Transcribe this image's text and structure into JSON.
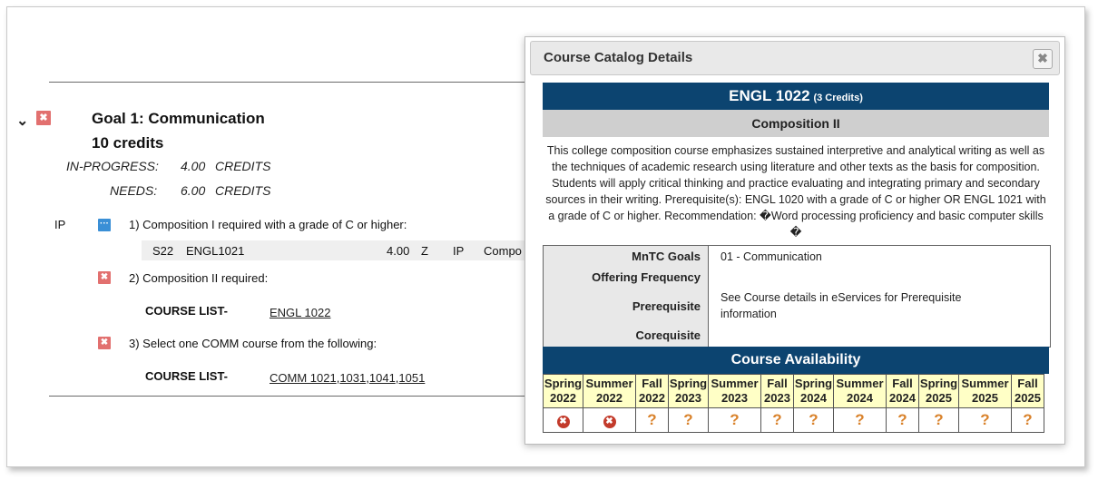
{
  "goal": {
    "title": "Goal 1: Communication",
    "credits": "10 credits",
    "in_progress_label": "IN-PROGRESS:",
    "in_progress_value": "4.00",
    "in_progress_unit": "CREDITS",
    "needs_label": "NEEDS:",
    "needs_value": "6.00",
    "needs_unit": "CREDITS"
  },
  "requirements": [
    {
      "status": "IP",
      "text": "1) Composition I required with a grade of C or higher:",
      "course_row": {
        "term": "S22",
        "course": "ENGL1021",
        "credits": "4.00",
        "flag": "Z",
        "status": "IP",
        "title": "Compo"
      }
    },
    {
      "text": "2) Composition II required:",
      "course_list_label": "COURSE LIST-",
      "courses": "ENGL 1022"
    },
    {
      "text": "3) Select one COMM course from the following:",
      "course_list_label": "COURSE LIST-",
      "courses": [
        "COMM 1021",
        "1031",
        "1041",
        "1051"
      ]
    }
  ],
  "dialog": {
    "title": "Course Catalog Details",
    "close_glyph": "✖",
    "course_code": "ENGL 1022",
    "course_credits": "(3 Credits)",
    "course_name": "Composition II",
    "description": "This college composition course emphasizes sustained interpretive and analytical writing as well as the techniques of academic research using literature and other texts as the basis for composition. Students will apply critical thinking and practice evaluating and integrating primary and secondary sources in their writing. Prerequisite(s): ENGL 1020 with a grade of C or higher OR ENGL 1021 with a grade of C or higher. Recommendation: �Word processing proficiency and basic computer skills �",
    "info": {
      "mntc_label": "MnTC Goals",
      "mntc_value": "01 - Communication",
      "frequency_label": "Offering Frequency",
      "frequency_value": "",
      "prereq_label": "Prerequisite",
      "prereq_value": "See Course details in eServices for Prerequisite information",
      "coreq_label": "Corequisite",
      "coreq_value": ""
    },
    "availability_title": "Course Availability",
    "terms": [
      {
        "season": "Spring",
        "year": "2022",
        "status": "not-offered"
      },
      {
        "season": "Summer",
        "year": "2022",
        "status": "not-offered"
      },
      {
        "season": "Fall",
        "year": "2022",
        "status": "unknown"
      },
      {
        "season": "Spring",
        "year": "2023",
        "status": "unknown"
      },
      {
        "season": "Summer",
        "year": "2023",
        "status": "unknown"
      },
      {
        "season": "Fall",
        "year": "2023",
        "status": "unknown"
      },
      {
        "season": "Spring",
        "year": "2024",
        "status": "unknown"
      },
      {
        "season": "Summer",
        "year": "2024",
        "status": "unknown"
      },
      {
        "season": "Fall",
        "year": "2024",
        "status": "unknown"
      },
      {
        "season": "Spring",
        "year": "2025",
        "status": "unknown"
      },
      {
        "season": "Summer",
        "year": "2025",
        "status": "unknown"
      },
      {
        "season": "Fall",
        "year": "2025",
        "status": "unknown"
      }
    ],
    "status_glyphs": {
      "not-offered": "✖",
      "unknown": "?"
    }
  },
  "icons": {
    "chevron": "chevron-down-icon",
    "remove": "remove-x-icon",
    "more": "more-dots-icon"
  },
  "colors": {
    "navy": "#0c4470",
    "term_bg": "#ffffc6",
    "remove_icon": "#e2706f",
    "more_icon": "#3a8fd6",
    "x_circle": "#c33b2b",
    "question": "#d9822b"
  }
}
